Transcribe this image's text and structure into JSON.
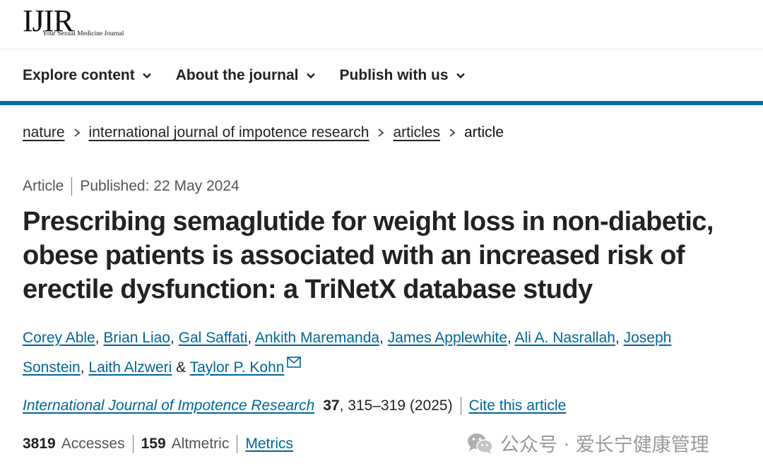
{
  "logo": {
    "mark": "IJIR",
    "tagline": "Your Sexual Medicine Journal"
  },
  "nav": {
    "items": [
      {
        "label": "Explore content"
      },
      {
        "label": "About the journal"
      },
      {
        "label": "Publish with us"
      }
    ]
  },
  "breadcrumb": {
    "links": [
      "nature",
      "international journal of impotence research",
      "articles"
    ],
    "current": "article"
  },
  "meta": {
    "type": "Article",
    "published": "Published: 22 May 2024"
  },
  "article": {
    "title": "Prescribing semaglutide for weight loss in non-diabetic, obese patients is associated with an increased risk of erectile dysfunction: a TriNetX database study"
  },
  "authors": {
    "list": [
      "Corey Able",
      "Brian Liao",
      "Gal Saffati",
      "Ankith Maremanda",
      "James Applewhite",
      "Ali A. Nasrallah",
      "Joseph Sonstein",
      "Laith Alzweri",
      "Taylor P. Kohn"
    ],
    "separator": ", ",
    "last_separator": " & "
  },
  "citation": {
    "journal": "International Journal of Impotence Research",
    "volume": "37",
    "pages_year": ", 315–319 (2025)",
    "cite_label": "Cite this article"
  },
  "metrics": {
    "accesses_value": "3819",
    "accesses_label": "Accesses",
    "altmetric_value": "159",
    "altmetric_label": "Altmetric",
    "metrics_link": "Metrics"
  },
  "watermark": {
    "text": "公众号 · 爱长宁健康管理",
    "icon": "wechat-icon"
  },
  "colors": {
    "accent_bar": "#0070a8",
    "link": "#006699"
  }
}
